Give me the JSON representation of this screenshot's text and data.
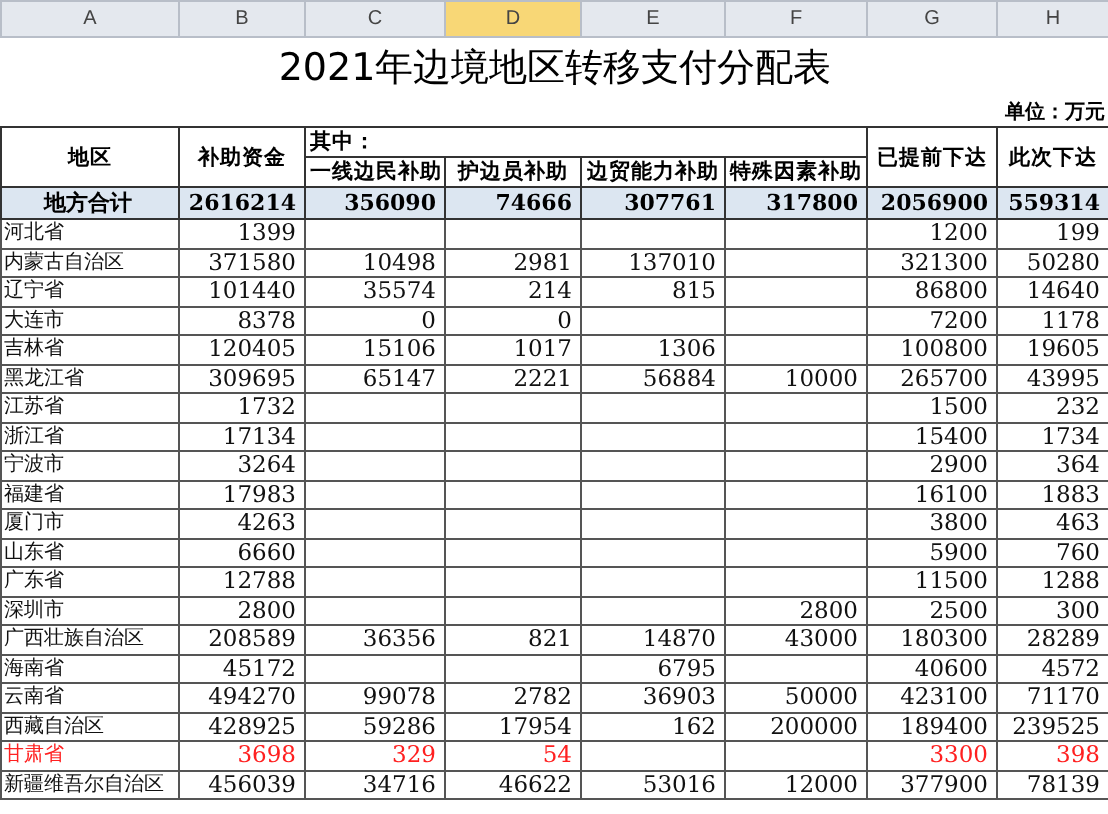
{
  "column_letters": [
    {
      "label": "A",
      "selected": false
    },
    {
      "label": "B",
      "selected": false
    },
    {
      "label": "C",
      "selected": false
    },
    {
      "label": "D",
      "selected": true
    },
    {
      "label": "E",
      "selected": false
    },
    {
      "label": "F",
      "selected": false
    },
    {
      "label": "G",
      "selected": false
    },
    {
      "label": "H",
      "selected": false
    }
  ],
  "title": "2021年边境地区转移支付分配表",
  "unit": "单位：万元",
  "header": {
    "region": "地区",
    "funds": "补助资金",
    "of_which": "其中：",
    "sub_columns": [
      "一线边民补助",
      "护边员补助",
      "边贸能力补助",
      "特殊因素补助"
    ],
    "advanced": "已提前下达",
    "this_time": "此次下达"
  },
  "total": {
    "name": "地方合计",
    "funds": "2616214",
    "frontier": "356090",
    "guard": "74666",
    "trade": "307761",
    "special": "317800",
    "advanced": "2056900",
    "this_time": "559314"
  },
  "rows": [
    {
      "name": "河北省",
      "red": false,
      "funds": "1399",
      "advanced": "1200",
      "this_time": "199"
    },
    {
      "name": "内蒙古自治区",
      "red": false,
      "funds": "371580",
      "frontier": "10498",
      "guard": "2981",
      "trade": "137010",
      "advanced": "321300",
      "this_time": "50280"
    },
    {
      "name": "辽宁省",
      "red": false,
      "funds": "101440",
      "frontier": "35574",
      "guard": "214",
      "trade": "815",
      "advanced": "86800",
      "this_time": "14640"
    },
    {
      "name": "大连市",
      "red": false,
      "funds": "8378",
      "frontier": "0",
      "guard": "0",
      "advanced": "7200",
      "this_time": "1178"
    },
    {
      "name": "吉林省",
      "red": false,
      "funds": "120405",
      "frontier": "15106",
      "guard": "1017",
      "trade": "1306",
      "advanced": "100800",
      "this_time": "19605"
    },
    {
      "name": "黑龙江省",
      "red": false,
      "funds": "309695",
      "frontier": "65147",
      "guard": "2221",
      "trade": "56884",
      "special": "10000",
      "advanced": "265700",
      "this_time": "43995"
    },
    {
      "name": "江苏省",
      "red": false,
      "funds": "1732",
      "advanced": "1500",
      "this_time": "232"
    },
    {
      "name": "浙江省",
      "red": false,
      "funds": "17134",
      "advanced": "15400",
      "this_time": "1734"
    },
    {
      "name": "宁波市",
      "red": false,
      "funds": "3264",
      "advanced": "2900",
      "this_time": "364"
    },
    {
      "name": "福建省",
      "red": false,
      "funds": "17983",
      "advanced": "16100",
      "this_time": "1883"
    },
    {
      "name": "厦门市",
      "red": false,
      "funds": "4263",
      "advanced": "3800",
      "this_time": "463"
    },
    {
      "name": "山东省",
      "red": false,
      "funds": "6660",
      "advanced": "5900",
      "this_time": "760"
    },
    {
      "name": "广东省",
      "red": false,
      "funds": "12788",
      "advanced": "11500",
      "this_time": "1288"
    },
    {
      "name": "深圳市",
      "red": false,
      "funds": "2800",
      "special": "2800",
      "advanced": "2500",
      "this_time": "300"
    },
    {
      "name": "广西壮族自治区",
      "red": false,
      "funds": "208589",
      "frontier": "36356",
      "guard": "821",
      "trade": "14870",
      "special": "43000",
      "advanced": "180300",
      "this_time": "28289"
    },
    {
      "name": "海南省",
      "red": false,
      "funds": "45172",
      "trade": "6795",
      "advanced": "40600",
      "this_time": "4572"
    },
    {
      "name": "云南省",
      "red": false,
      "funds": "494270",
      "frontier": "99078",
      "guard": "2782",
      "trade": "36903",
      "special": "50000",
      "advanced": "423100",
      "this_time": "71170"
    },
    {
      "name": "西藏自治区",
      "red": false,
      "funds": "428925",
      "frontier": "59286",
      "guard": "17954",
      "trade": "162",
      "special": "200000",
      "advanced": "189400",
      "this_time": "239525"
    },
    {
      "name": "甘肃省",
      "red": true,
      "funds": "3698",
      "frontier": "329",
      "guard": "54",
      "advanced": "3300",
      "this_time": "398"
    },
    {
      "name": "新疆维吾尔自治区",
      "red": false,
      "funds": "456039",
      "frontier": "34716",
      "guard": "46622",
      "trade": "53016",
      "special": "12000",
      "advanced": "377900",
      "this_time": "78139"
    }
  ]
}
